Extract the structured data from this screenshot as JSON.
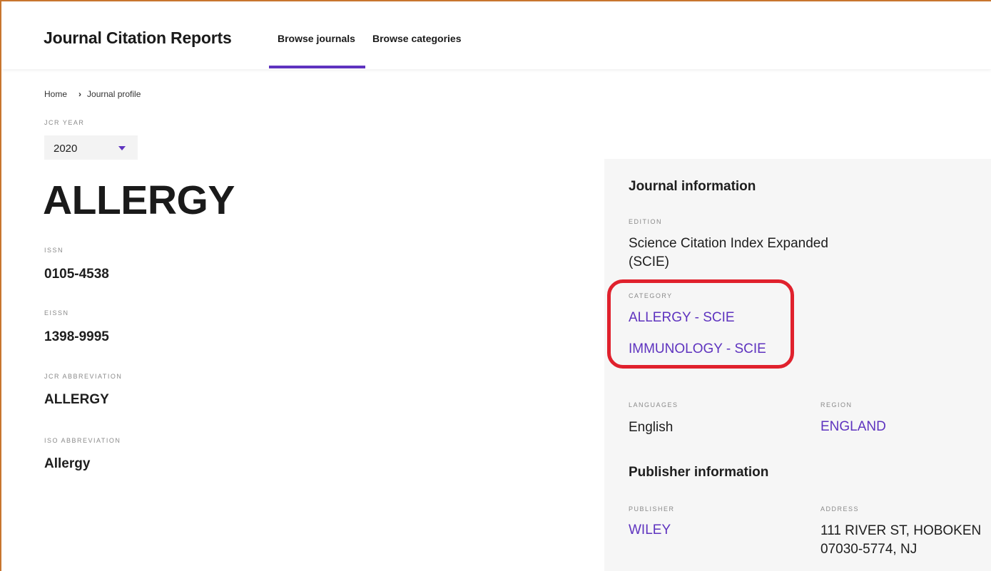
{
  "header": {
    "app_title": "Journal Citation Reports",
    "nav": [
      {
        "label": "Browse journals",
        "active": true
      },
      {
        "label": "Browse categories",
        "active": false
      }
    ],
    "accent_color": "#5e33bf"
  },
  "breadcrumb": {
    "home": "Home",
    "current": "Journal profile"
  },
  "jcr_year": {
    "label": "JCR YEAR",
    "selected": "2020"
  },
  "journal": {
    "title": "ALLERGY",
    "fields": [
      {
        "label": "ISSN",
        "value": "0105-4538"
      },
      {
        "label": "EISSN",
        "value": "1398-9995"
      },
      {
        "label": "JCR ABBREVIATION",
        "value": "ALLERGY"
      },
      {
        "label": "ISO ABBREVIATION",
        "value": "Allergy"
      }
    ]
  },
  "journal_information": {
    "heading": "Journal information",
    "edition_label": "EDITION",
    "edition_value_line1": "Science Citation Index Expanded",
    "edition_value_line2": "(SCIE)",
    "category_label": "CATEGORY",
    "categories": [
      "ALLERGY - SCIE",
      "IMMUNOLOGY - SCIE"
    ],
    "languages_label": "LANGUAGES",
    "languages_value": "English",
    "region_label": "REGION",
    "region_value": "ENGLAND"
  },
  "publisher_information": {
    "heading": "Publisher information",
    "publisher_label": "PUBLISHER",
    "publisher_value": "WILEY",
    "address_label": "ADDRESS",
    "address_line1": "111 RIVER ST, HOBOKEN",
    "address_line2": "07030-5774, NJ"
  },
  "annotation": {
    "highlight_color": "#e0212d"
  }
}
